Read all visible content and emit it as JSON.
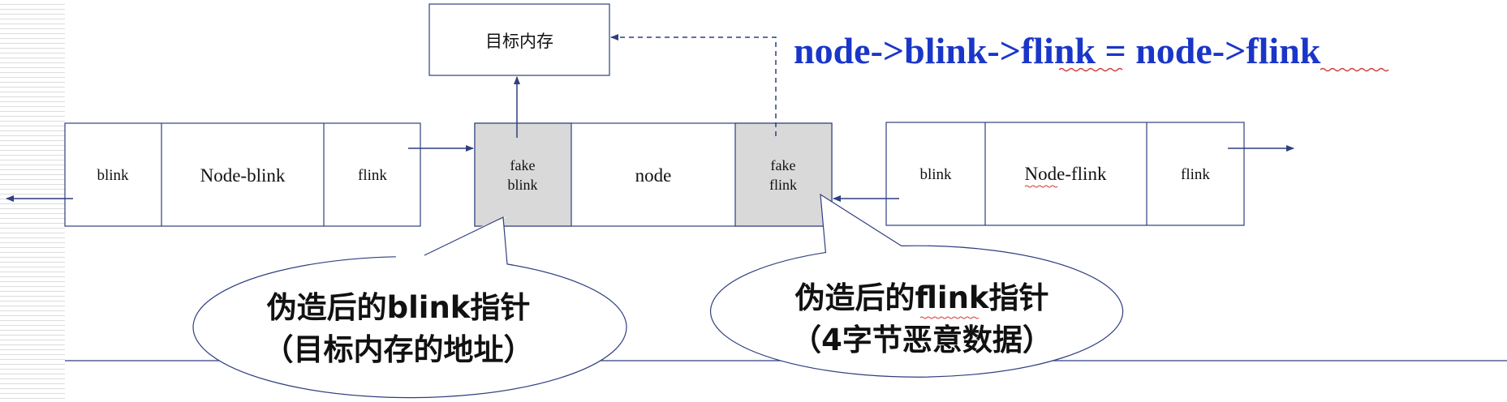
{
  "heading": "node->blink->flink = node->flink",
  "target_memory": "目标内存",
  "left_node": {
    "blink": "blink",
    "data": "Node-blink",
    "flink": "flink"
  },
  "middle_node": {
    "fake_blink": [
      "fake",
      "blink"
    ],
    "data": "node",
    "fake_flink": [
      "fake",
      "flink"
    ]
  },
  "right_node": {
    "blink": "blink",
    "data": "Node-flink",
    "flink": "flink"
  },
  "callout_blink": [
    "伪造后的blink指针",
    "（目标内存的地址）"
  ],
  "callout_flink": [
    "伪造后的flink指针",
    "（4字节恶意数据）"
  ],
  "colors": {
    "heading": "#1a36c8",
    "border": "#2f3f7f",
    "fake_cell": "#d9d9d9",
    "arrow": "#2f3f7f"
  }
}
